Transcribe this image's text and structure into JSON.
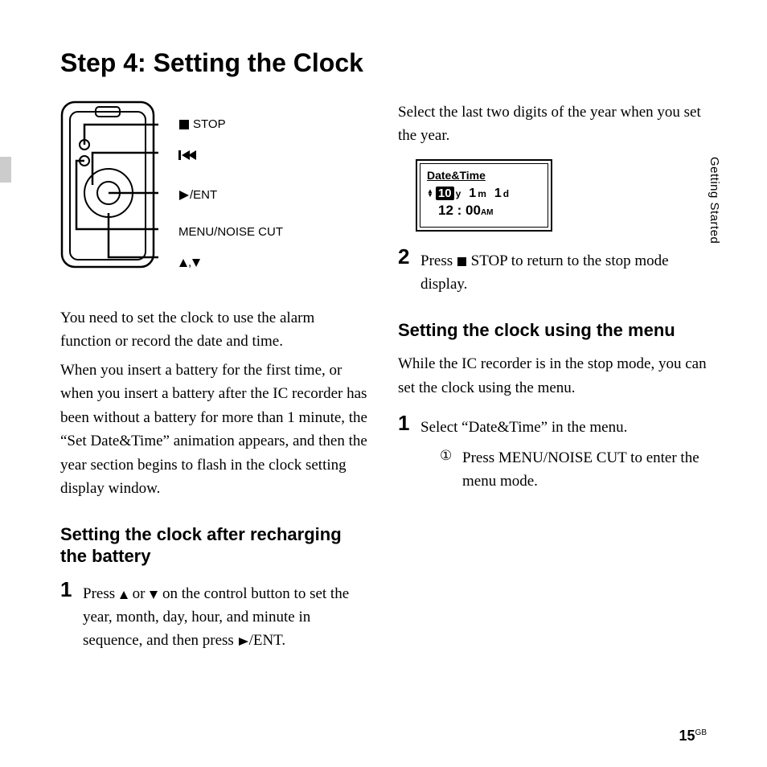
{
  "page_title": "Step 4: Setting the Clock",
  "section_tab": "Getting Started",
  "diagram_labels": {
    "stop": "STOP",
    "ent_suffix": "/ENT",
    "menu": "MENU/NOISE CUT"
  },
  "left_col": {
    "p1": "You need to set the clock to use the alarm function or record the date and time.",
    "p2": "When you insert a battery for the first time, or when you insert a battery after the IC recorder has been without a battery for more than 1 minute, the “Set Date&Time” animation appears, and then the year section begins to flash in the clock setting display window.",
    "h1": "Setting the clock after recharging the battery",
    "step1_prefix": "Press ",
    "step1_mid": " or ",
    "step1_body": " on the control button to set the year, month, day, hour, and minute in sequence, and then press ",
    "step1_suffix": "/ENT."
  },
  "right_col": {
    "p1": "Select the last two digits of the year when you set the year.",
    "step2_prefix": "Press ",
    "step2_body": " STOP to return to the stop mode display.",
    "h1": "Setting the clock using the menu",
    "p2": "While the IC recorder is in the stop mode, you can set the clock using the menu.",
    "step1": "Select “Date&Time” in the menu.",
    "sub1": "Press MENU/NOISE CUT to enter the menu mode."
  },
  "lcd": {
    "title": "Date&Time",
    "year": "10",
    "y_suffix": "y",
    "month": "1",
    "m_suffix": "m",
    "day": "1",
    "d_suffix": "d",
    "time": "12 : 00",
    "ampm": "AM"
  },
  "page_number": "15",
  "page_number_sup": "GB"
}
